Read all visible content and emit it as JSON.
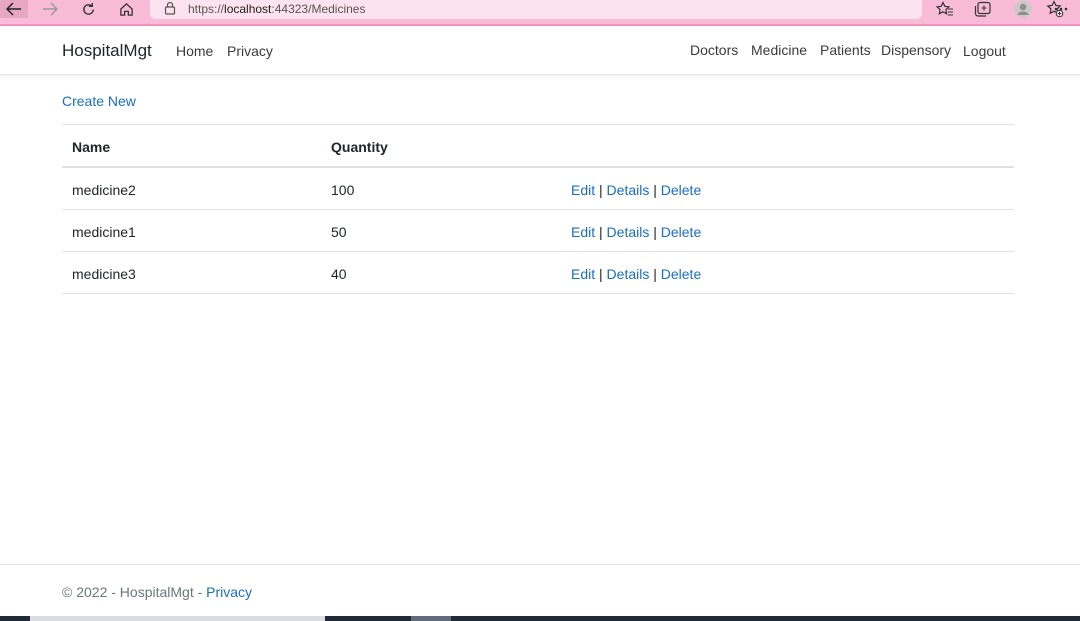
{
  "browser": {
    "url_prefix": "https://",
    "url_host": "localhost",
    "url_rest": ":44323/Medicines",
    "read_aloud_label": "Aᴬ"
  },
  "navbar": {
    "brand": "HospitalMgt",
    "left_links": [
      "Home",
      "Privacy"
    ],
    "right_links": [
      "Doctors",
      "Medicine",
      "Patients",
      "Dispensory",
      "Logout"
    ]
  },
  "page": {
    "create_new": "Create New"
  },
  "table": {
    "headers": [
      "Name",
      "Quantity"
    ],
    "rows": [
      {
        "name": "medicine2",
        "quantity": "100"
      },
      {
        "name": "medicine1",
        "quantity": "50"
      },
      {
        "name": "medicine3",
        "quantity": "40"
      }
    ],
    "actions": [
      "Edit",
      "Details",
      "Delete"
    ],
    "separator": "|"
  },
  "footer": {
    "text": "© 2022 - HospitalMgt - ",
    "link": "Privacy"
  },
  "colors": {
    "browser_chrome": "#f9bcd8",
    "link": "#1a6ec2",
    "text": "#212529",
    "muted": "#6c757d"
  },
  "icons": [
    "back-arrow-icon",
    "forward-arrow-icon",
    "refresh-icon",
    "home-icon",
    "lock-icon",
    "read-aloud-icon",
    "add-favorite-icon",
    "favorites-icon",
    "collections-icon",
    "profile-icon",
    "more-icon"
  ]
}
